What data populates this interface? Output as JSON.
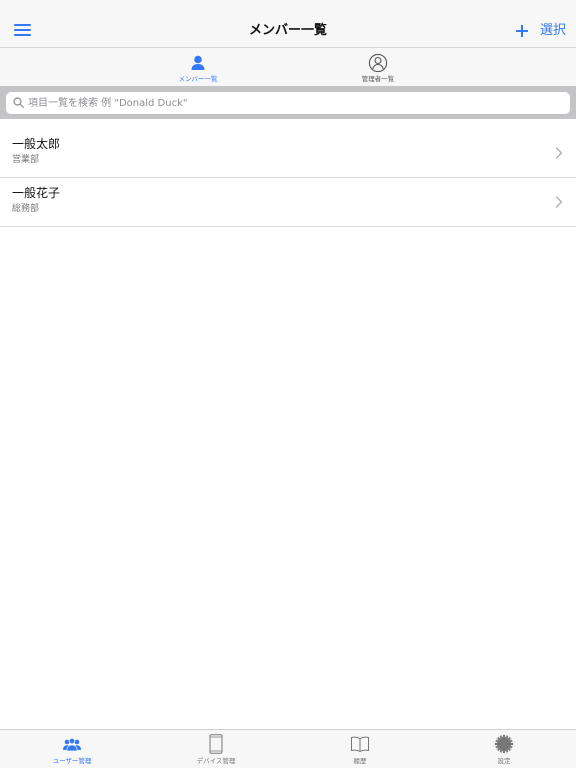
{
  "navbar": {
    "title": "メンバー一覧",
    "menu_icon": "hamburger-menu-icon",
    "add_icon": "plus-icon",
    "select_label": "選択",
    "accent_color": "#3478f6"
  },
  "tabs": [
    {
      "label": "メンバー一覧",
      "icon": "person-icon",
      "selected": true
    },
    {
      "label": "管理者一覧",
      "icon": "person-circle-icon",
      "selected": false
    }
  ],
  "search": {
    "placeholder": "項目一覧を検索 例 \"Donald Duck\"",
    "value": ""
  },
  "members": [
    {
      "name": "一般太郎",
      "department": "営業部"
    },
    {
      "name": "一般花子",
      "department": "総務部"
    }
  ],
  "tabbar": [
    {
      "label": "ユーザー管理",
      "icon": "users-group-icon",
      "selected": true
    },
    {
      "label": "デバイス管理",
      "icon": "tablet-icon",
      "selected": false
    },
    {
      "label": "履歴",
      "icon": "book-icon",
      "selected": false
    },
    {
      "label": "設定",
      "icon": "gear-icon",
      "selected": false
    }
  ]
}
